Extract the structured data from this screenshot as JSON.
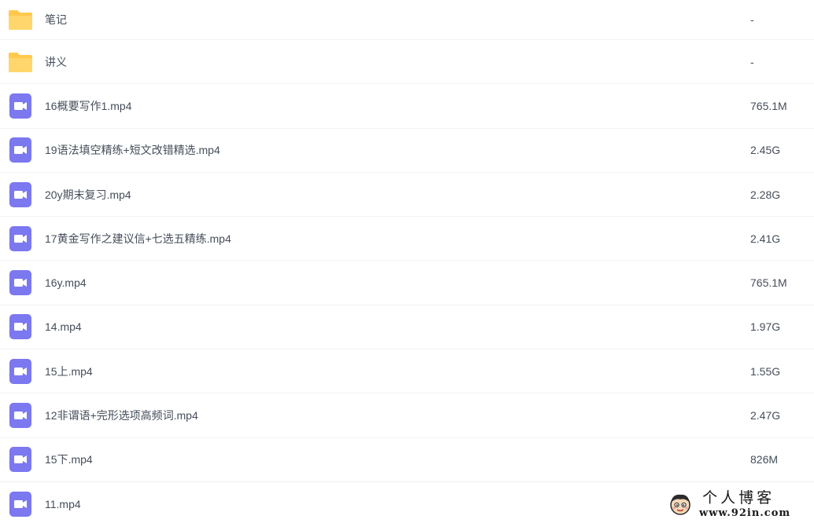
{
  "files": [
    {
      "icon": "folder-icon",
      "name": "笔记",
      "size": "-"
    },
    {
      "icon": "folder-icon",
      "name": "讲义",
      "size": "-"
    },
    {
      "icon": "video-file-icon",
      "name": "16概要写作1.mp4",
      "size": "765.1M"
    },
    {
      "icon": "video-file-icon",
      "name": "19语法填空精练+短文改错精选.mp4",
      "size": "2.45G"
    },
    {
      "icon": "video-file-icon",
      "name": "20y期末复习.mp4",
      "size": "2.28G"
    },
    {
      "icon": "video-file-icon",
      "name": "17黄金写作之建议信+七选五精练.mp4",
      "size": "2.41G"
    },
    {
      "icon": "video-file-icon",
      "name": "16y.mp4",
      "size": "765.1M"
    },
    {
      "icon": "video-file-icon",
      "name": "14.mp4",
      "size": "1.97G"
    },
    {
      "icon": "video-file-icon",
      "name": "15上.mp4",
      "size": "1.55G"
    },
    {
      "icon": "video-file-icon",
      "name": "12非谓语+完形选项高频词.mp4",
      "size": "2.47G"
    },
    {
      "icon": "video-file-icon",
      "name": "15下.mp4",
      "size": "826M"
    },
    {
      "icon": "video-file-icon",
      "name": "11.mp4",
      "size": ""
    }
  ],
  "watermark": {
    "title": "个人博客",
    "url": "www.92in.com"
  },
  "colors": {
    "folder": "#ffc94d",
    "video": "#7b78f0",
    "text": "#454d5a",
    "divider": "#f1f2f4"
  }
}
